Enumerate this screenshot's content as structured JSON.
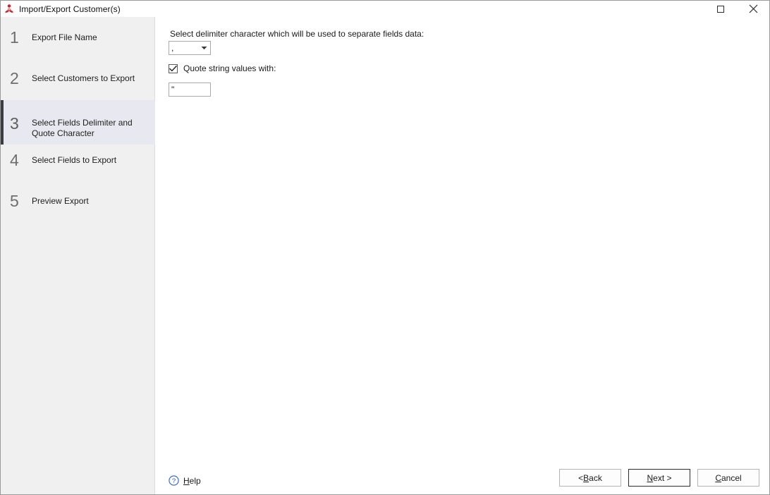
{
  "window": {
    "title": "Import/Export Customer(s)",
    "icon": "app-red-icon",
    "controls": {
      "maximize": "maximize-icon",
      "close": "close-icon"
    }
  },
  "sidebar": {
    "selected_index": 2,
    "steps": [
      {
        "number": "1",
        "label": "Export File Name"
      },
      {
        "number": "2",
        "label": "Select Customers to Export"
      },
      {
        "number": "3",
        "label": "Select Fields Delimiter and Quote Character"
      },
      {
        "number": "4",
        "label": "Select Fields to Export"
      },
      {
        "number": "5",
        "label": "Preview Export"
      }
    ]
  },
  "main": {
    "delimiter_prompt": "Select delimiter character which will be used to separate fields data:",
    "delimiter_value": ",",
    "quote_checkbox": {
      "label": "Quote string values with:",
      "checked": true
    },
    "quote_value": "\""
  },
  "footer": {
    "help": {
      "icon": "question-circle-icon",
      "prefix": "",
      "accel": "H",
      "suffix": "elp"
    },
    "buttons": [
      {
        "name": "back",
        "prefix": "< ",
        "accel": "B",
        "suffix": "ack",
        "default": false
      },
      {
        "name": "next",
        "prefix": "",
        "accel": "N",
        "suffix": "ext >",
        "default": true
      },
      {
        "name": "cancel",
        "prefix": "",
        "accel": "C",
        "suffix": "ancel",
        "default": false
      }
    ]
  },
  "colors": {
    "sidebar_bg": "#f0f0f0",
    "selected_bg": "#e8e8f0",
    "accent_bar": "#3b3b44",
    "content_bg": "#ffffff",
    "icon_red": "#cf2127",
    "help_blue": "#2a5fc8"
  }
}
